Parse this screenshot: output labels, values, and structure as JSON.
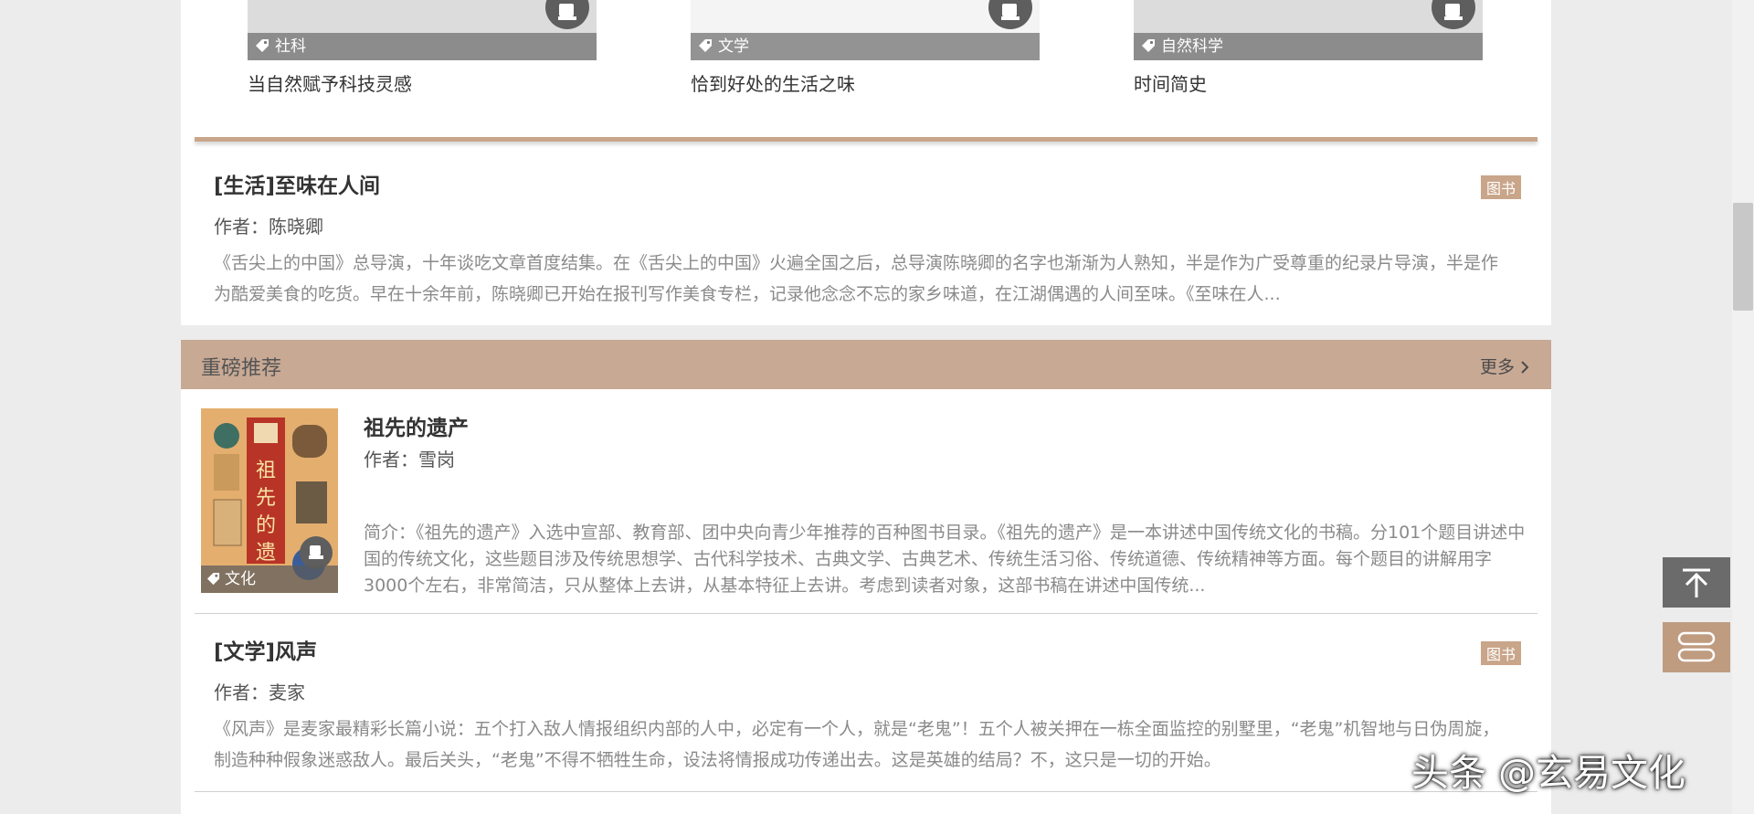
{
  "top_cards": [
    {
      "category": "社科",
      "title": "当自然赋予科技灵感"
    },
    {
      "category": "文学",
      "title": "恰到好处的生活之味"
    },
    {
      "category": "自然科学",
      "title": "时间简史"
    }
  ],
  "article1": {
    "title": "[生活]至味在人间",
    "author": "作者：陈晓卿",
    "type": "图书",
    "description": "《舌尖上的中国》总导演，十年谈吃文章首度结集。在《舌尖上的中国》火遍全国之后，总导演陈晓卿的名字也渐渐为人熟知，半是作为广受尊重的纪录片导演，半是作为酷爱美食的吃货。早在十余年前，陈晓卿已开始在报刊写作美食专栏，记录他念念不忘的家乡味道，在江湖偶遇的人间至味。《至味在人..."
  },
  "section": {
    "title": "重磅推荐",
    "more": "更多"
  },
  "featured": {
    "category": "文化",
    "title": "祖先的遗产",
    "author": "作者：雪岗",
    "description": "简介：《祖先的遗产》入选中宣部、教育部、团中央向青少年推荐的百种图书目录。《祖先的遗产》是一本讲述中国传统文化的书稿。分101个题目讲述中国的传统文化，这些题目涉及传统思想学、古代科学技术、古典文学、古典艺术、传统生活习俗、传统道德、传统精神等方面。每个题目的讲解用字3000个左右，非常简洁，只从整体上去讲，从基本特征上去讲。考虑到读者对象，这部书稿在讲述中国传统..."
  },
  "article2": {
    "title": "[文学]风声",
    "author": "作者：麦家",
    "type": "图书",
    "description": "《风声》是麦家最精彩长篇小说：五个打入敌人情报组织内部的人中，必定有一个人，就是“老鬼”！五个人被关押在一栋全面监控的别墅里，“老鬼”机智地与日伪周旋，制造种种假象迷惑敌人。最后关头，“老鬼”不得不牺牲生命，设法将情报成功传递出去。这是英雄的结局？不，这只是一切的开始。"
  },
  "watermark": "头条 @玄易文化",
  "icons": {
    "tag": "tag-icon",
    "book_badge": "book-icon",
    "back_to_top": "arrow-up-icon",
    "menu": "menu-icon"
  },
  "colors": {
    "accent": "#c8a994",
    "badge": "#c9a58a"
  }
}
